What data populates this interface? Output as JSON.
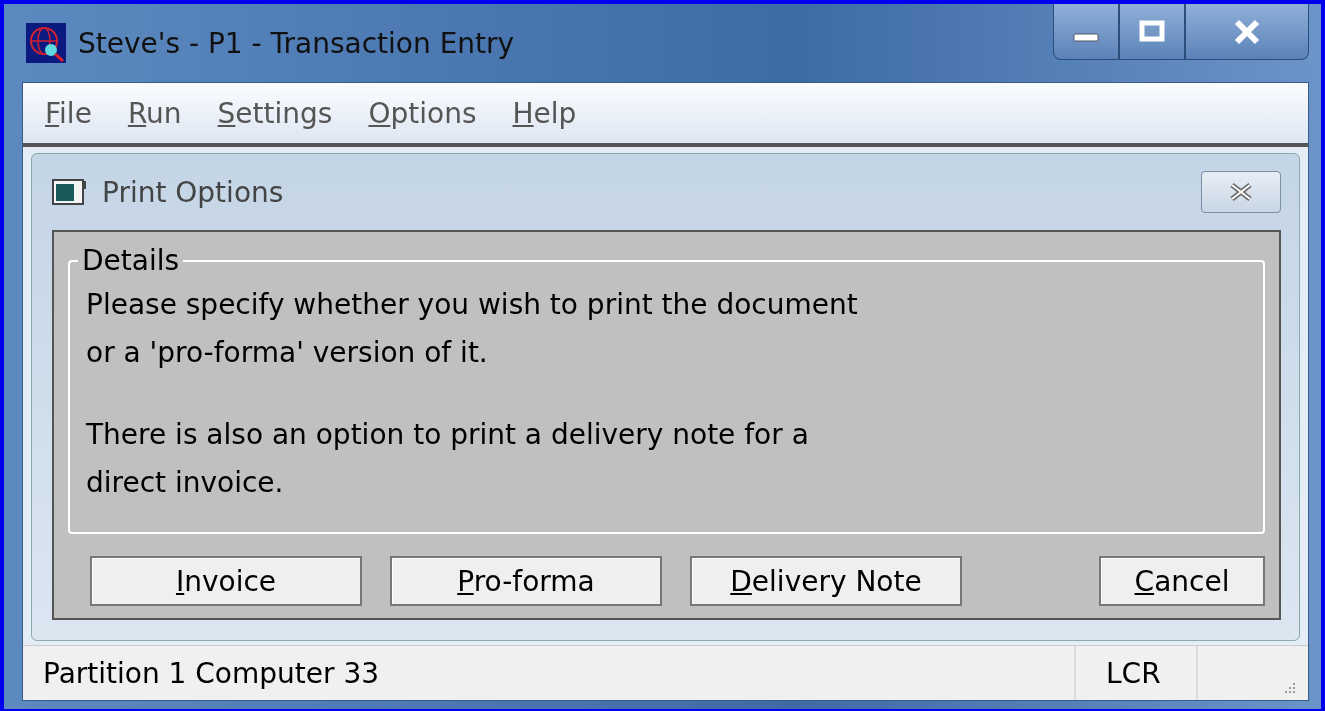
{
  "window": {
    "title": "Steve's - P1 - Transaction Entry"
  },
  "menu": [
    {
      "label": "File"
    },
    {
      "label": "Run"
    },
    {
      "label": "Settings"
    },
    {
      "label": "Options"
    },
    {
      "label": "Help"
    }
  ],
  "dialog": {
    "title": "Print Options",
    "group_title": "Details",
    "paragraphs": [
      "Please specify whether you wish to print the document\nor a 'pro-forma' version of it.",
      "There is also an option to print a delivery note for a\ndirect invoice."
    ],
    "buttons": [
      {
        "label": "Invoice"
      },
      {
        "label": "Pro-forma"
      },
      {
        "label": "Delivery Note"
      },
      {
        "label": "Cancel"
      }
    ]
  },
  "status_bar": [
    "Partition 1 Computer 33",
    "LCR"
  ]
}
